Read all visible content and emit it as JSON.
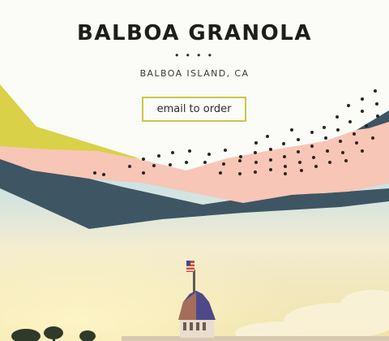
{
  "site": {
    "title": "BALBOA GRANOLA",
    "divider": "• • • •",
    "location": "BALBOA ISLAND, CA",
    "cta_label": "email to order"
  },
  "colors": {
    "background": "#fbfbf7",
    "mustard": "#d9d148",
    "slate": "#3e5563",
    "peach": "#f7c6b6",
    "accent_border": "#cfc44a",
    "text": "#1f1d1c"
  },
  "icons": {
    "flag": "american-flag-icon"
  }
}
